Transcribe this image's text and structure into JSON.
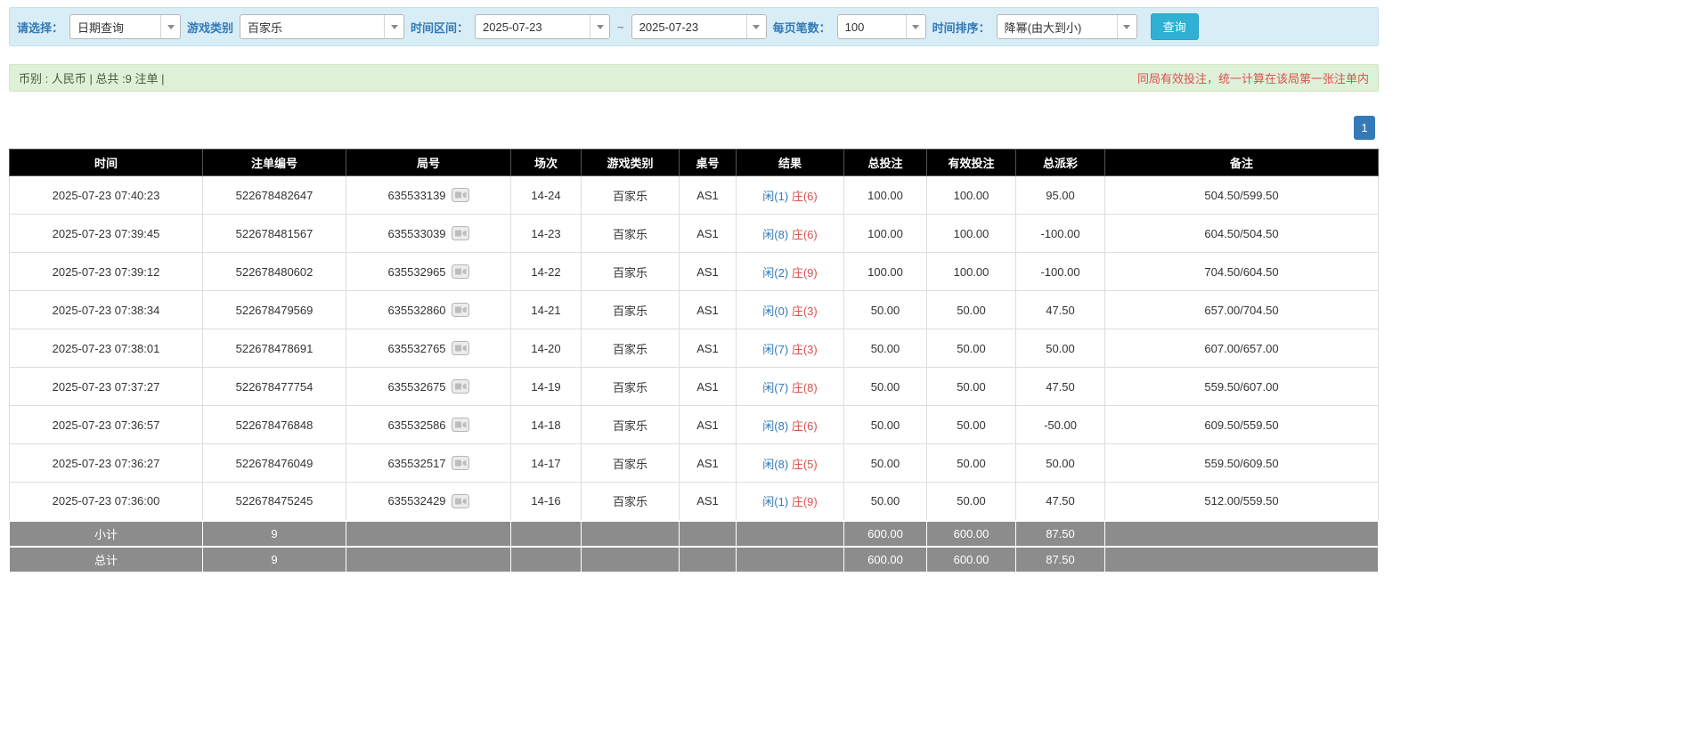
{
  "filter": {
    "select_label": "请选择：",
    "select_value": "日期查询",
    "game_label": "游戏类别",
    "game_value": "百家乐",
    "range_label": "时间区间：",
    "date_from": "2025-07-23",
    "range_separator": "~",
    "date_to": "2025-07-23",
    "per_page_label": "每页笔数：",
    "per_page_value": "100",
    "sort_label": "时间排序：",
    "sort_value": "降幂(由大到小)",
    "query_button": "查询"
  },
  "info_bar": {
    "summary": "币别 : 人民币 | 总共 :9 注单 |",
    "notice": "同局有效投注，统一计算在该局第一张注单内"
  },
  "pagination": {
    "current_page": "1"
  },
  "table": {
    "headers": [
      "时间",
      "注单编号",
      "局号",
      "场次",
      "游戏类别",
      "桌号",
      "结果",
      "总投注",
      "有效投注",
      "总派彩",
      "备注"
    ],
    "rows": [
      {
        "time": "2025-07-23 07:40:23",
        "bet_id": "522678482647",
        "round": "635533139",
        "session": "14-24",
        "game": "百家乐",
        "table_no": "AS1",
        "result_player": "闲(1)",
        "result_banker": "庄(6)",
        "total_bet": "100.00",
        "valid_bet": "100.00",
        "payout": "95.00",
        "remark": "504.50/599.50"
      },
      {
        "time": "2025-07-23 07:39:45",
        "bet_id": "522678481567",
        "round": "635533039",
        "session": "14-23",
        "game": "百家乐",
        "table_no": "AS1",
        "result_player": "闲(8)",
        "result_banker": "庄(6)",
        "total_bet": "100.00",
        "valid_bet": "100.00",
        "payout": "-100.00",
        "remark": "604.50/504.50"
      },
      {
        "time": "2025-07-23 07:39:12",
        "bet_id": "522678480602",
        "round": "635532965",
        "session": "14-22",
        "game": "百家乐",
        "table_no": "AS1",
        "result_player": "闲(2)",
        "result_banker": "庄(9)",
        "total_bet": "100.00",
        "valid_bet": "100.00",
        "payout": "-100.00",
        "remark": "704.50/604.50"
      },
      {
        "time": "2025-07-23 07:38:34",
        "bet_id": "522678479569",
        "round": "635532860",
        "session": "14-21",
        "game": "百家乐",
        "table_no": "AS1",
        "result_player": "闲(0)",
        "result_banker": "庄(3)",
        "total_bet": "50.00",
        "valid_bet": "50.00",
        "payout": "47.50",
        "remark": "657.00/704.50"
      },
      {
        "time": "2025-07-23 07:38:01",
        "bet_id": "522678478691",
        "round": "635532765",
        "session": "14-20",
        "game": "百家乐",
        "table_no": "AS1",
        "result_player": "闲(7)",
        "result_banker": "庄(3)",
        "total_bet": "50.00",
        "valid_bet": "50.00",
        "payout": "50.00",
        "remark": "607.00/657.00"
      },
      {
        "time": "2025-07-23 07:37:27",
        "bet_id": "522678477754",
        "round": "635532675",
        "session": "14-19",
        "game": "百家乐",
        "table_no": "AS1",
        "result_player": "闲(7)",
        "result_banker": "庄(8)",
        "total_bet": "50.00",
        "valid_bet": "50.00",
        "payout": "47.50",
        "remark": "559.50/607.00"
      },
      {
        "time": "2025-07-23 07:36:57",
        "bet_id": "522678476848",
        "round": "635532586",
        "session": "14-18",
        "game": "百家乐",
        "table_no": "AS1",
        "result_player": "闲(8)",
        "result_banker": "庄(6)",
        "total_bet": "50.00",
        "valid_bet": "50.00",
        "payout": "-50.00",
        "remark": "609.50/559.50"
      },
      {
        "time": "2025-07-23 07:36:27",
        "bet_id": "522678476049",
        "round": "635532517",
        "session": "14-17",
        "game": "百家乐",
        "table_no": "AS1",
        "result_player": "闲(8)",
        "result_banker": "庄(5)",
        "total_bet": "50.00",
        "valid_bet": "50.00",
        "payout": "50.00",
        "remark": "559.50/609.50"
      },
      {
        "time": "2025-07-23 07:36:00",
        "bet_id": "522678475245",
        "round": "635532429",
        "session": "14-16",
        "game": "百家乐",
        "table_no": "AS1",
        "result_player": "闲(1)",
        "result_banker": "庄(9)",
        "total_bet": "50.00",
        "valid_bet": "50.00",
        "payout": "47.50",
        "remark": "512.00/559.50"
      }
    ],
    "subtotal": {
      "label": "小计",
      "count": "9",
      "total_bet": "600.00",
      "valid_bet": "600.00",
      "payout": "87.50"
    },
    "grand_total": {
      "label": "总计",
      "count": "9",
      "total_bet": "600.00",
      "valid_bet": "600.00",
      "payout": "87.50"
    }
  },
  "colors": {
    "accent_blue": "#337ab7",
    "danger_red": "#d9534f",
    "query_button_bg": "#31b0d5",
    "filter_bar_bg": "#d9edf7",
    "info_bar_bg": "#dff0d8",
    "table_header_bg": "#000000",
    "table_footer_bg": "#8c8c8c"
  }
}
